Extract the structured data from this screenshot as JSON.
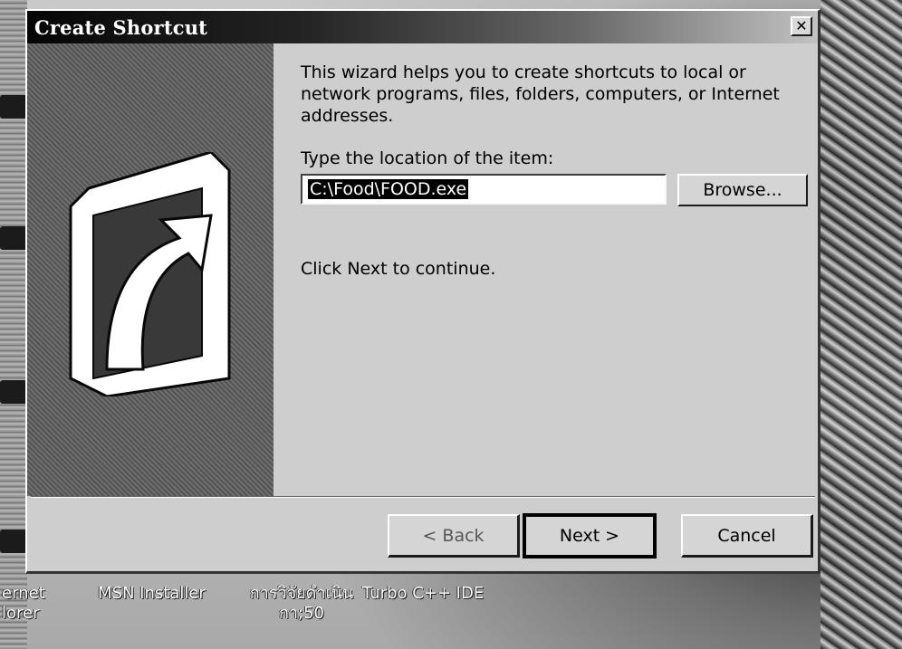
{
  "dialog": {
    "title": "Create Shortcut",
    "close_glyph": "✕",
    "intro": "This wizard helps you to create shortcuts to local or network programs, files, folders, computers, or Internet addresses.",
    "location_label": "Type the location of the item:",
    "location_value": "C:\\Food\\FOOD.exe",
    "browse_label": "Browse...",
    "continue_text": "Click Next to continue.",
    "back_label": "< Back",
    "next_label": "Next >",
    "cancel_label": "Cancel",
    "banner_icon": "shortcut-arrow-icon"
  },
  "desktop": {
    "icons": [
      {
        "label_line1": "ernet",
        "label_line2": "lorer"
      },
      {
        "label_line1": "MSN Installer",
        "label_line2": ""
      },
      {
        "label_line1": "การวิจัยดำเนิน",
        "label_line2": "กา;50"
      },
      {
        "label_line1": "Turbo C++ IDE",
        "label_line2": ""
      }
    ]
  },
  "colors": {
    "dialog_face": "#c8c8c8",
    "titlebar_start": "#0f0f0f",
    "titlebar_end": "#bdbdbd",
    "banner": "#5a5a5a",
    "selection": "#0a0a0a"
  }
}
